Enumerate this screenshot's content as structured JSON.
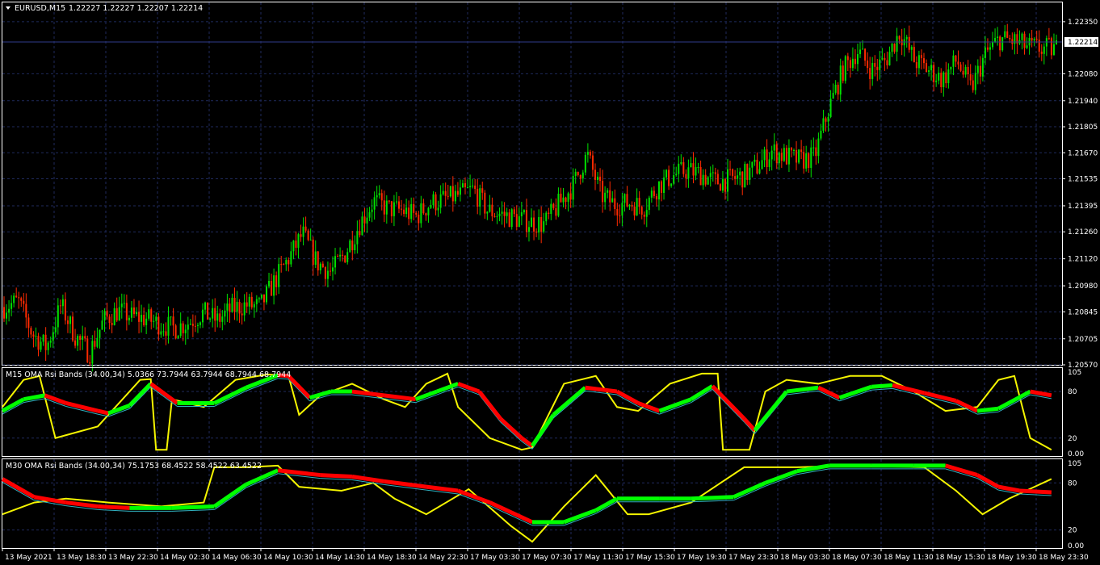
{
  "main_panel": {
    "symbol_label": "EURUSD,M15",
    "ohlc_values": "1.22227 1.22227 1.22207 1.22214",
    "current_price": "1.22214",
    "price_ticks": [
      "1.22350",
      "1.22080",
      "1.21940",
      "1.21805",
      "1.21670",
      "1.21535",
      "1.21395",
      "1.21260",
      "1.21120",
      "1.20980",
      "1.20845",
      "1.20705",
      "1.20570"
    ]
  },
  "indicator_1": {
    "label": "M15 OMA Rsi Bands (34.00,34) 5.0366 73.7944 63.7944 68.7944 68.7944",
    "ticks": [
      "105",
      "80",
      "20",
      "0.00"
    ]
  },
  "indicator_2": {
    "label": "M30 OMA Rsi Bands (34.00,34) 75.1753 68.4522 58.4522 63.4522",
    "ticks": [
      "105",
      "80",
      "20",
      "0.00"
    ]
  },
  "time_axis": [
    "13 May 2021",
    "13 May 18:30",
    "13 May 22:30",
    "14 May 02:30",
    "14 May 06:30",
    "14 May 10:30",
    "14 May 14:30",
    "14 May 18:30",
    "14 May 22:30",
    "17 May 03:30",
    "17 May 07:30",
    "17 May 11:30",
    "17 May 15:30",
    "17 May 19:30",
    "17 May 23:30",
    "18 May 03:30",
    "18 May 07:30",
    "18 May 11:30",
    "18 May 15:30",
    "18 May 19:30",
    "18 May 23:30"
  ],
  "colors": {
    "background": "#000000",
    "grid": "#1f2a5c",
    "bull_candle": "#00e000",
    "bear_candle": "#ff2a00",
    "rsi_line": "#f5f500",
    "band_up": "#00ff00",
    "band_down": "#ff0000",
    "frame": "#ffffff"
  },
  "chart_data": {
    "type": "line",
    "title": "EURUSD,M15",
    "x_labels": [
      "13 May 2021",
      "13 May 18:30",
      "13 May 22:30",
      "14 May 02:30",
      "14 May 06:30",
      "14 May 10:30",
      "14 May 14:30",
      "14 May 18:30",
      "14 May 22:30",
      "17 May 03:30",
      "17 May 07:30",
      "17 May 11:30",
      "17 May 15:30",
      "17 May 19:30",
      "17 May 23:30",
      "18 May 03:30",
      "18 May 07:30",
      "18 May 11:30",
      "18 May 15:30",
      "18 May 19:30",
      "18 May 23:30"
    ],
    "ylim": [
      1.2057,
      1.2245
    ],
    "series": [
      {
        "name": "EURUSD,M15",
        "values": [
          1.2087,
          1.209,
          1.2073,
          1.2066,
          1.2088,
          1.2072,
          1.2063,
          1.208,
          1.2085,
          1.2082,
          1.2081,
          1.2078,
          1.2076,
          1.2079,
          1.2084,
          1.208,
          1.2086,
          1.2088,
          1.2087,
          1.21,
          1.2112,
          1.2125,
          1.211,
          1.2105,
          1.2115,
          1.213,
          1.2142,
          1.2138,
          1.2137,
          1.2134,
          1.2141,
          1.2143,
          1.2145,
          1.2148,
          1.2137,
          1.2135,
          1.2133,
          1.2131,
          1.213,
          1.214,
          1.215,
          1.2166,
          1.2145,
          1.214,
          1.2141,
          1.2139,
          1.215,
          1.2155,
          1.2158,
          1.2156,
          1.2152,
          1.2153,
          1.2155,
          1.216,
          1.2168,
          1.2165,
          1.2163,
          1.2165,
          1.219,
          1.221,
          1.222,
          1.221,
          1.2215,
          1.223,
          1.2215,
          1.221,
          1.2205,
          1.2215,
          1.22,
          1.2218,
          1.2226,
          1.2225,
          1.2222,
          1.2221,
          1.2221
        ]
      }
    ]
  }
}
